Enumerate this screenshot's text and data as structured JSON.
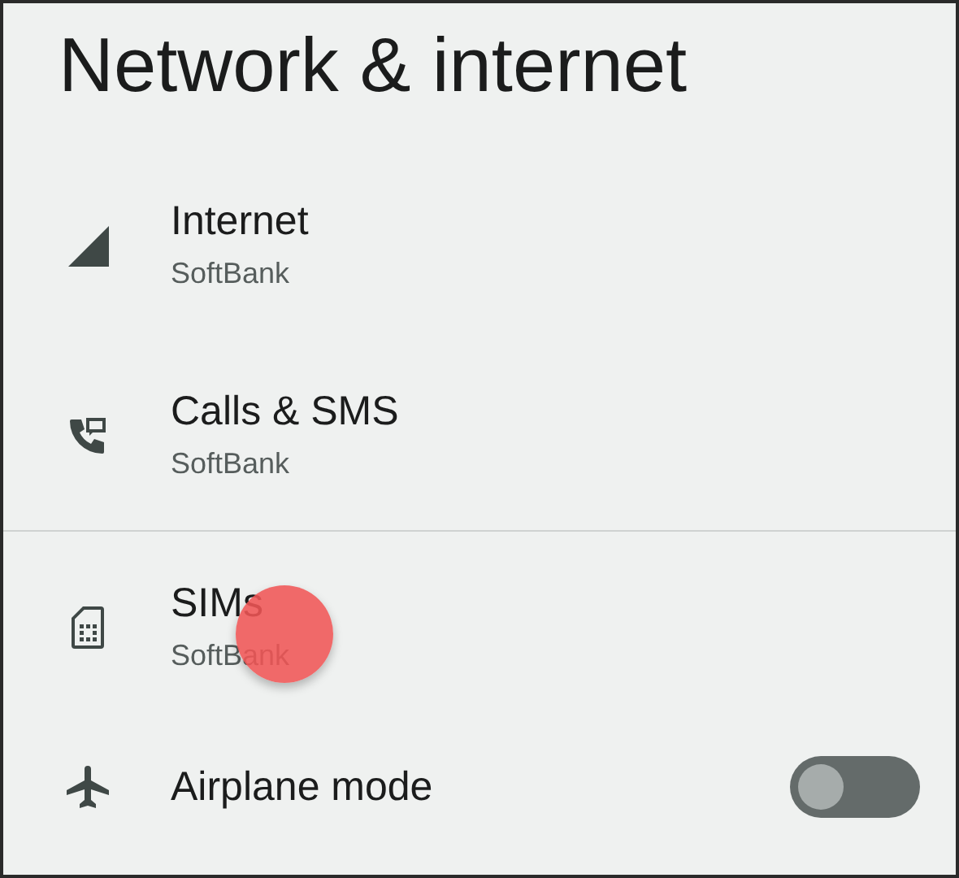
{
  "title": "Network & internet",
  "sections": [
    {
      "items": [
        {
          "kind": "link",
          "label": "Internet",
          "summary": "SoftBank"
        },
        {
          "kind": "link",
          "label": "Calls & SMS",
          "summary": "SoftBank"
        }
      ]
    },
    {
      "items": [
        {
          "kind": "link",
          "label": "SIMs",
          "summary": "SoftBank"
        },
        {
          "kind": "toggle",
          "label": "Airplane mode",
          "on": false
        }
      ]
    }
  ]
}
